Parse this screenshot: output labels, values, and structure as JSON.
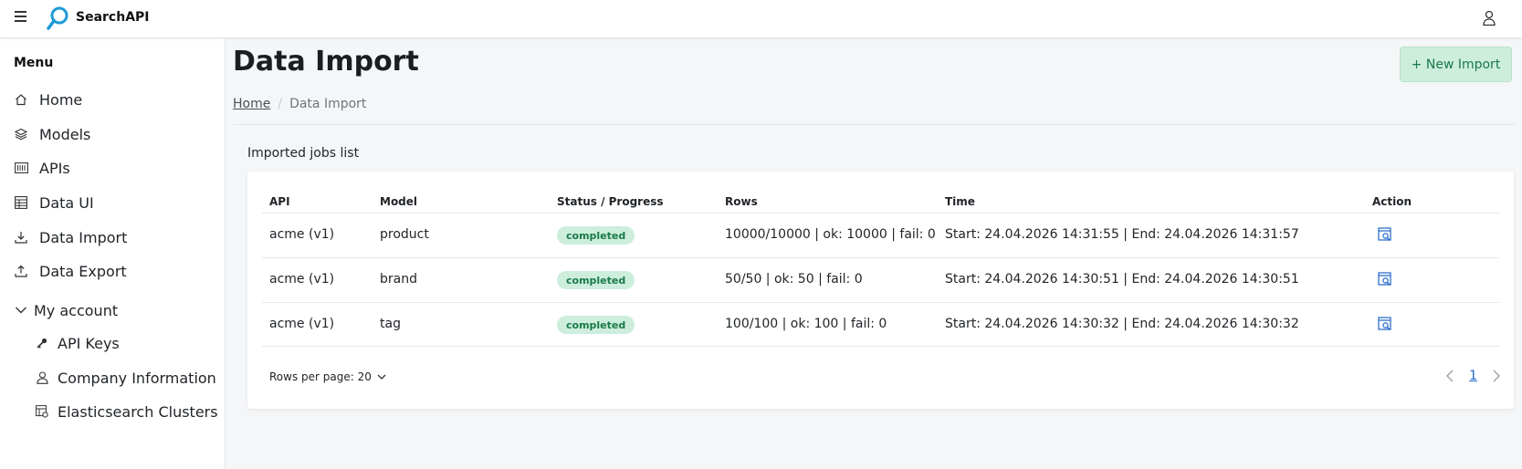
{
  "header": {
    "brand": "SearchAPI"
  },
  "sidebar": {
    "title": "Menu",
    "items": [
      {
        "label": "Home",
        "icon": "home-icon"
      },
      {
        "label": "Models",
        "icon": "layers-icon"
      },
      {
        "label": "APIs",
        "icon": "api-icon"
      },
      {
        "label": "Data UI",
        "icon": "table-icon"
      },
      {
        "label": "Data Import",
        "icon": "download-icon"
      },
      {
        "label": "Data Export",
        "icon": "upload-icon"
      }
    ],
    "account": {
      "label": "My account",
      "items": [
        {
          "label": "API Keys",
          "icon": "key-icon"
        },
        {
          "label": "Company Information",
          "icon": "user-icon"
        },
        {
          "label": "Elasticsearch Clusters",
          "icon": "cluster-icon"
        }
      ]
    }
  },
  "page": {
    "title": "Data Import",
    "new_button": "+ New Import",
    "breadcrumb": {
      "home": "Home",
      "separator": "/",
      "current": "Data Import"
    },
    "section_title": "Imported jobs list"
  },
  "table": {
    "columns": [
      "API",
      "Model",
      "Status / Progress",
      "Rows",
      "Time",
      "Action"
    ],
    "rows": [
      {
        "api": "acme (v1)",
        "model": "product",
        "status": "completed",
        "rows": "10000/10000 | ok: 10000 | fail: 0",
        "time": "Start: 24.04.2026 14:31:55 | End: 24.04.2026 14:31:57"
      },
      {
        "api": "acme (v1)",
        "model": "brand",
        "status": "completed",
        "rows": "50/50 | ok: 50 | fail: 0",
        "time": "Start: 24.04.2026 14:30:51 | End: 24.04.2026 14:30:51"
      },
      {
        "api": "acme (v1)",
        "model": "tag",
        "status": "completed",
        "rows": "100/100 | ok: 100 | fail: 0",
        "time": "Start: 24.04.2026 14:30:32 | End: 24.04.2026 14:30:32"
      }
    ]
  },
  "pagination": {
    "rows_per_page": "Rows per page: 20",
    "current_page": "1"
  },
  "colors": {
    "accent": "#1f64c8",
    "success_bg": "#cdeedd",
    "success_text": "#197a49",
    "logo": "#1e9ad6"
  }
}
